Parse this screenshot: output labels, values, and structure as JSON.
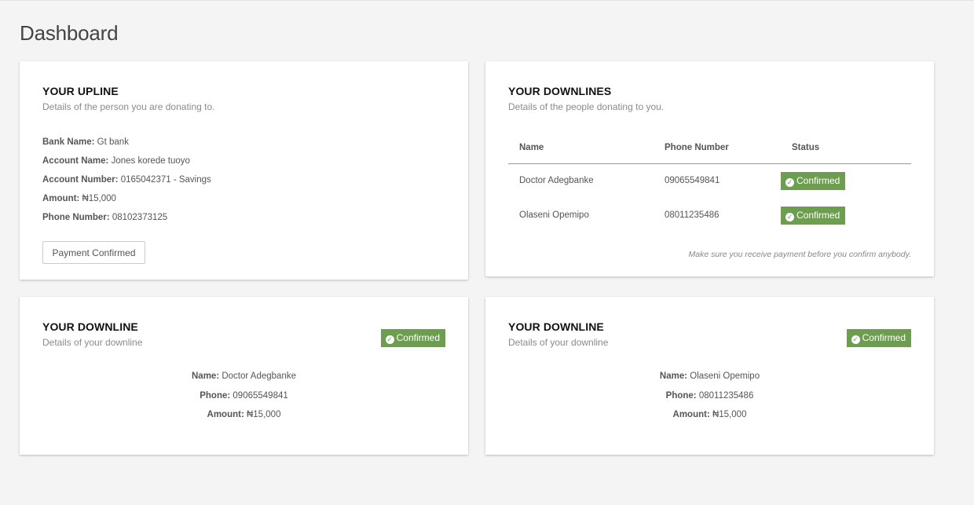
{
  "page": {
    "title": "Dashboard"
  },
  "upline": {
    "title": "YOUR UPLINE",
    "subtitle": "Details of the person you are donating to.",
    "details": [
      {
        "label": "Bank Name:",
        "value": "Gt bank"
      },
      {
        "label": "Account Name:",
        "value": "Jones korede tuoyo"
      },
      {
        "label": "Account Number:",
        "value": "0165042371 - Savings"
      },
      {
        "label": "Amount:",
        "value": "₦15,000"
      },
      {
        "label": "Phone Number:",
        "value": "08102373125"
      }
    ],
    "button_label": "Payment Confirmed"
  },
  "downlines": {
    "title": "YOUR DOWNLINES",
    "subtitle": "Details of the people donating to you.",
    "columns": [
      "Name",
      "Phone Number",
      "Status"
    ],
    "rows": [
      {
        "name": "Doctor Adegbanke",
        "phone": "09065549841",
        "status": "Confirmed"
      },
      {
        "name": "Olaseni Opemipo",
        "phone": "08011235486",
        "status": "Confirmed"
      }
    ],
    "note": "Make sure you receive payment before you confirm anybody."
  },
  "downline_cards": [
    {
      "title": "YOUR DOWNLINE",
      "subtitle": "Details of your downline",
      "status": "Confirmed",
      "details": [
        {
          "label": "Name:",
          "value": "Doctor Adegbanke"
        },
        {
          "label": "Phone:",
          "value": "09065549841"
        },
        {
          "label": "Amount:",
          "value": "₦15,000"
        }
      ]
    },
    {
      "title": "YOUR DOWNLINE",
      "subtitle": "Details of your downline",
      "status": "Confirmed",
      "details": [
        {
          "label": "Name:",
          "value": "Olaseni Opemipo"
        },
        {
          "label": "Phone:",
          "value": "08011235486"
        },
        {
          "label": "Amount:",
          "value": "₦15,000"
        }
      ]
    }
  ],
  "icons": {
    "status_icon": "check-circle-icon"
  },
  "colors": {
    "badge_green": "#6d9e4f",
    "background": "#f4f4f4"
  }
}
